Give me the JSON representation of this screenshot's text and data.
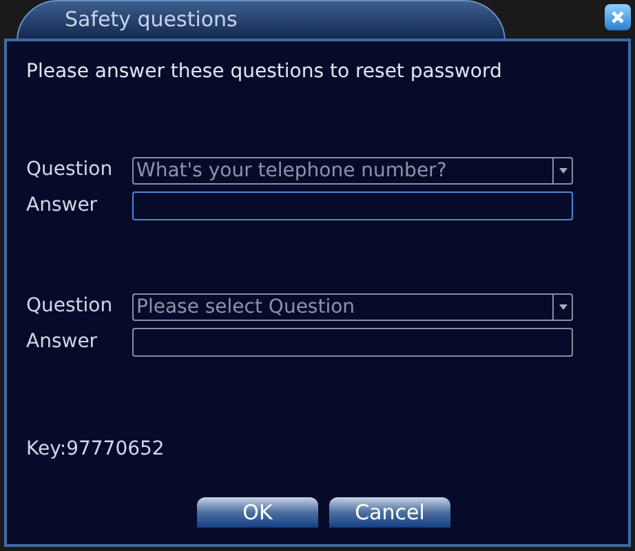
{
  "window": {
    "title": "Safety questions"
  },
  "instruction": "Please answer these questions to reset password",
  "groups": [
    {
      "question_label": "Question",
      "question_value": "What's your telephone number?",
      "answer_label": "Answer",
      "answer_focused": true
    },
    {
      "question_label": "Question",
      "question_value": "Please select Question",
      "answer_label": "Answer",
      "answer_focused": false
    }
  ],
  "key": "Key:97770652",
  "buttons": [
    "OK",
    "Cancel"
  ]
}
